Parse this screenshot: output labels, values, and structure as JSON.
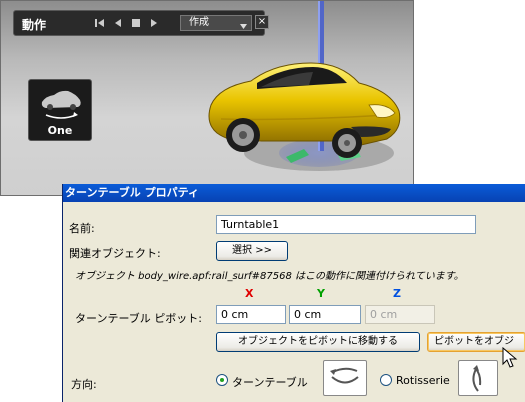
{
  "viewport": {
    "panel_title": "動作",
    "action_dropdown": "作成",
    "close_glyph": "×",
    "thumbnail_label": "One"
  },
  "dialog": {
    "title": "ターンテーブル プロパティ",
    "name_label": "名前:",
    "name_value": "Turntable1",
    "related_object_label": "関連オブジェクト:",
    "select_button": "選択 >>",
    "info_text": "オブジェクト body_wire.apf:rail_surf#87568 はこの動作に関連付けられています。",
    "axes": {
      "x": "X",
      "y": "Y",
      "z": "Z"
    },
    "axis_colors": {
      "x": "#e00000",
      "y": "#00a000",
      "z": "#0050e0"
    },
    "pivot_label": "ターンテーブル ピボット:",
    "pivot_x": "0 cm",
    "pivot_y": "0 cm",
    "pivot_z": "0 cm",
    "move_obj_button": "オブジェクトをピボットに移動する",
    "move_pivot_button": "ピボットをオブジ",
    "direction_label": "方向:",
    "option_turntable": "ターンテーブル",
    "option_rotisserie": "Rotisserie",
    "selected_option": "turntable"
  }
}
